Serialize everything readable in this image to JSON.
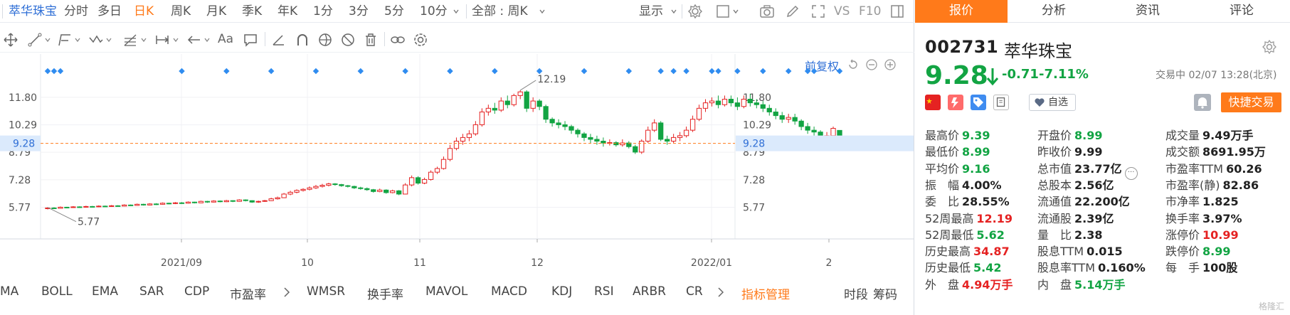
{
  "period_bar": {
    "stock_name": "萃华珠宝",
    "periods": [
      "分时",
      "多日",
      "日K",
      "周K",
      "月K",
      "季K",
      "年K",
      "1分",
      "3分",
      "5分",
      "10分"
    ],
    "active_period": "日K",
    "overlay_select": "全部 : 周K",
    "display_label": "显示",
    "vs_label": "VS",
    "f10_label": "F10"
  },
  "chart_toolbar": {
    "adjust_label": "前复权"
  },
  "chart_data": {
    "type": "candlestick",
    "x_tick_labels": [
      "2021/09",
      "10",
      "11",
      "12",
      "2022/01",
      "2"
    ],
    "y_tick_labels": [
      "11.80",
      "10.29",
      "8.79",
      "7.28",
      "5.77"
    ],
    "y_ticks": [
      11.8,
      10.29,
      8.79,
      7.28,
      5.77
    ],
    "ylim": [
      4.9,
      13.2
    ],
    "current_price": 9.28,
    "current_price_label": "9.28",
    "high_marker": {
      "value": 12.19,
      "label": "12.19"
    },
    "low_marker": {
      "value": 5.77,
      "label": "5.77"
    },
    "candles": [
      [
        5.7,
        5.74,
        5.66,
        5.78
      ],
      [
        5.74,
        5.72,
        5.68,
        5.78
      ],
      [
        5.72,
        5.78,
        5.7,
        5.82
      ],
      [
        5.78,
        5.76,
        5.72,
        5.8
      ],
      [
        5.76,
        5.8,
        5.74,
        5.84
      ],
      [
        5.8,
        5.78,
        5.75,
        5.83
      ],
      [
        5.78,
        5.82,
        5.76,
        5.86
      ],
      [
        5.82,
        5.8,
        5.77,
        5.85
      ],
      [
        5.8,
        5.84,
        5.78,
        5.88
      ],
      [
        5.84,
        5.82,
        5.79,
        5.87
      ],
      [
        5.82,
        5.86,
        5.8,
        5.9
      ],
      [
        5.86,
        5.84,
        5.81,
        5.89
      ],
      [
        5.84,
        5.9,
        5.82,
        5.94
      ],
      [
        5.9,
        5.88,
        5.85,
        5.93
      ],
      [
        5.88,
        5.94,
        5.86,
        5.98
      ],
      [
        5.94,
        5.9,
        5.87,
        5.97
      ],
      [
        5.9,
        5.96,
        5.88,
        6.0
      ],
      [
        5.96,
        5.94,
        5.9,
        6.0
      ],
      [
        5.94,
        6.0,
        5.92,
        6.04
      ],
      [
        6.0,
        5.98,
        5.94,
        6.03
      ],
      [
        5.98,
        6.02,
        5.95,
        6.06
      ],
      [
        6.02,
        6.0,
        5.96,
        6.06
      ],
      [
        6.0,
        6.06,
        5.98,
        6.1
      ],
      [
        6.06,
        6.02,
        5.99,
        6.08
      ],
      [
        6.02,
        6.1,
        6.0,
        6.14
      ],
      [
        6.1,
        6.06,
        6.02,
        6.13
      ],
      [
        6.06,
        6.12,
        6.04,
        6.16
      ],
      [
        6.12,
        6.08,
        6.05,
        6.15
      ],
      [
        6.08,
        6.14,
        6.06,
        6.18
      ],
      [
        6.14,
        6.1,
        6.06,
        6.16
      ],
      [
        6.1,
        6.18,
        6.08,
        6.22
      ],
      [
        6.18,
        6.14,
        6.1,
        6.21
      ],
      [
        6.14,
        6.06,
        6.02,
        6.16
      ],
      [
        6.06,
        6.1,
        6.02,
        6.14
      ],
      [
        6.1,
        6.14,
        6.07,
        6.18
      ],
      [
        6.14,
        6.24,
        6.12,
        6.3
      ],
      [
        6.24,
        6.3,
        6.2,
        6.36
      ],
      [
        6.3,
        6.5,
        6.28,
        6.56
      ],
      [
        6.5,
        6.6,
        6.44,
        6.68
      ],
      [
        6.6,
        6.7,
        6.54,
        6.76
      ],
      [
        6.7,
        6.76,
        6.64,
        6.82
      ],
      [
        6.76,
        6.84,
        6.7,
        6.92
      ],
      [
        6.84,
        6.92,
        6.78,
        7.0
      ],
      [
        6.92,
        6.98,
        6.86,
        7.06
      ],
      [
        6.98,
        7.06,
        6.92,
        7.12
      ],
      [
        7.06,
        7.02,
        6.96,
        7.1
      ],
      [
        7.02,
        6.96,
        6.9,
        7.06
      ],
      [
        6.96,
        6.92,
        6.86,
        7.0
      ],
      [
        6.92,
        6.84,
        6.78,
        6.96
      ],
      [
        6.84,
        6.8,
        6.74,
        6.9
      ],
      [
        6.8,
        6.74,
        6.68,
        6.86
      ],
      [
        6.74,
        6.64,
        6.58,
        6.78
      ],
      [
        6.64,
        6.72,
        6.6,
        6.8
      ],
      [
        6.72,
        6.58,
        6.52,
        6.76
      ],
      [
        6.58,
        6.68,
        6.54,
        6.74
      ],
      [
        6.68,
        6.5,
        6.44,
        6.72
      ],
      [
        6.5,
        7.0,
        6.48,
        7.1
      ],
      [
        7.0,
        7.4,
        6.92,
        7.52
      ],
      [
        7.4,
        7.1,
        7.02,
        7.48
      ],
      [
        7.1,
        7.3,
        7.04,
        7.4
      ],
      [
        7.3,
        7.7,
        7.24,
        7.8
      ],
      [
        7.7,
        7.9,
        7.6,
        8.0
      ],
      [
        7.9,
        8.4,
        7.84,
        8.56
      ],
      [
        8.4,
        9.0,
        8.3,
        9.2
      ],
      [
        9.0,
        9.4,
        8.9,
        9.6
      ],
      [
        9.4,
        9.6,
        9.2,
        9.8
      ],
      [
        9.6,
        9.8,
        9.4,
        10.0
      ],
      [
        9.8,
        10.3,
        9.7,
        10.5
      ],
      [
        10.3,
        11.0,
        10.2,
        11.2
      ],
      [
        11.0,
        11.2,
        10.8,
        11.4
      ],
      [
        11.2,
        11.1,
        10.9,
        11.5
      ],
      [
        11.1,
        11.6,
        11.0,
        11.8
      ],
      [
        11.6,
        11.4,
        11.2,
        11.9
      ],
      [
        11.4,
        11.9,
        11.3,
        12.0
      ],
      [
        11.9,
        12.1,
        11.7,
        12.19
      ],
      [
        12.1,
        11.2,
        11.0,
        12.19
      ],
      [
        11.2,
        11.6,
        11.0,
        11.8
      ],
      [
        11.6,
        11.3,
        11.1,
        11.7
      ],
      [
        11.3,
        10.6,
        10.4,
        11.4
      ],
      [
        10.6,
        10.4,
        10.2,
        10.7
      ],
      [
        10.4,
        10.3,
        10.1,
        10.6
      ],
      [
        10.3,
        10.2,
        10.0,
        10.5
      ],
      [
        10.2,
        10.0,
        9.8,
        10.3
      ],
      [
        10.0,
        9.8,
        9.6,
        10.1
      ],
      [
        9.8,
        9.6,
        9.4,
        9.9
      ],
      [
        9.6,
        9.5,
        9.3,
        9.8
      ],
      [
        9.5,
        9.4,
        9.2,
        9.7
      ],
      [
        9.4,
        9.3,
        9.1,
        9.6
      ],
      [
        9.3,
        9.32,
        9.16,
        9.5
      ],
      [
        9.32,
        9.2,
        9.1,
        9.4
      ],
      [
        9.2,
        9.3,
        9.1,
        9.5
      ],
      [
        9.3,
        9.1,
        9.0,
        9.4
      ],
      [
        9.1,
        8.8,
        8.7,
        9.2
      ],
      [
        8.8,
        9.4,
        8.7,
        9.5
      ],
      [
        9.4,
        10.0,
        9.3,
        10.2
      ],
      [
        10.0,
        10.4,
        9.9,
        10.6
      ],
      [
        10.4,
        9.5,
        9.4,
        10.5
      ],
      [
        9.5,
        9.4,
        9.2,
        9.7
      ],
      [
        9.4,
        9.6,
        9.3,
        9.8
      ],
      [
        9.6,
        9.7,
        9.4,
        9.9
      ],
      [
        9.7,
        10.0,
        9.6,
        10.2
      ],
      [
        10.0,
        10.6,
        9.9,
        10.8
      ],
      [
        10.6,
        11.2,
        10.5,
        11.4
      ],
      [
        11.2,
        11.5,
        11.0,
        11.7
      ],
      [
        11.5,
        11.6,
        11.3,
        11.8
      ],
      [
        11.6,
        11.4,
        11.2,
        11.9
      ],
      [
        11.4,
        11.7,
        11.3,
        11.9
      ],
      [
        11.7,
        11.5,
        11.3,
        11.9
      ],
      [
        11.5,
        11.3,
        11.1,
        11.8
      ],
      [
        11.3,
        11.7,
        11.2,
        11.9
      ],
      [
        11.7,
        11.5,
        11.3,
        12.0
      ],
      [
        11.5,
        11.4,
        11.2,
        11.7
      ],
      [
        11.4,
        11.2,
        11.0,
        11.6
      ],
      [
        11.2,
        11.0,
        10.8,
        11.4
      ],
      [
        11.0,
        10.8,
        10.6,
        11.2
      ],
      [
        10.8,
        10.6,
        10.4,
        11.0
      ],
      [
        10.6,
        10.7,
        10.4,
        10.9
      ],
      [
        10.7,
        10.5,
        10.3,
        10.9
      ],
      [
        10.5,
        10.2,
        10.0,
        10.6
      ],
      [
        10.2,
        10.0,
        9.8,
        10.4
      ],
      [
        10.0,
        9.9,
        9.7,
        10.2
      ],
      [
        9.9,
        9.6,
        9.4,
        10.0
      ],
      [
        9.6,
        9.7,
        9.4,
        9.9
      ],
      [
        9.7,
        10.1,
        9.6,
        10.2
      ],
      [
        9.99,
        9.28,
        8.99,
        9.39
      ]
    ],
    "signal_markers_present": true
  },
  "indicators": {
    "items": [
      "MA",
      "BOLL",
      "EMA",
      "SAR",
      "CDP",
      "市盈率",
      "WMSR",
      "换手率",
      "MAVOL",
      "MACD",
      "KDJ",
      "RSI",
      "ARBR",
      "CR"
    ],
    "manage": "指标管理",
    "right_items": [
      "时段",
      "筹码"
    ]
  },
  "quote": {
    "tabs": [
      "报价",
      "分析",
      "资讯",
      "评论"
    ],
    "active_tab": "报价",
    "code": "002731",
    "name": "萃华珠宝",
    "price": "9.28",
    "change": "-0.71",
    "change_pct": "-7.11%",
    "status": "交易中 02/07 13:28(北京)",
    "watch_label": "自选",
    "quick_trade": "快捷交易",
    "fields": [
      {
        "k": "最高价",
        "v": "9.39",
        "c": "g"
      },
      {
        "k": "开盘价",
        "v": "8.99",
        "c": "g"
      },
      {
        "k": "成交量",
        "v": "9.49万手",
        "c": ""
      },
      {
        "k": "最低价",
        "v": "8.99",
        "c": "g"
      },
      {
        "k": "昨收价",
        "v": "9.99",
        "c": ""
      },
      {
        "k": "成交额",
        "v": "8691.95万",
        "c": ""
      },
      {
        "k": "平均价",
        "v": "9.16",
        "c": "g"
      },
      {
        "k": "总市值",
        "v": "23.77亿",
        "c": ""
      },
      {
        "k": "市盈率TTM",
        "v": "60.26",
        "c": ""
      },
      {
        "k": "振　幅",
        "v": "4.00%",
        "c": ""
      },
      {
        "k": "总股本",
        "v": "2.56亿",
        "c": ""
      },
      {
        "k": "市盈率(静)",
        "v": "82.86",
        "c": ""
      },
      {
        "k": "委　比",
        "v": "28.55%",
        "c": ""
      },
      {
        "k": "流通值",
        "v": "22.200亿",
        "c": ""
      },
      {
        "k": "市净率",
        "v": "1.825",
        "c": ""
      },
      {
        "k": "52周最高",
        "v": "12.19",
        "c": "r"
      },
      {
        "k": "流通股",
        "v": "2.39亿",
        "c": ""
      },
      {
        "k": "换手率",
        "v": "3.97%",
        "c": ""
      },
      {
        "k": "52周最低",
        "v": "5.62",
        "c": "g"
      },
      {
        "k": "量　比",
        "v": "2.38",
        "c": ""
      },
      {
        "k": "涨停价",
        "v": "10.99",
        "c": "r"
      },
      {
        "k": "历史最高",
        "v": "34.87",
        "c": "r"
      },
      {
        "k": "股息TTM",
        "v": "0.015",
        "c": ""
      },
      {
        "k": "跌停价",
        "v": "8.99",
        "c": "g"
      },
      {
        "k": "历史最低",
        "v": "5.42",
        "c": "g"
      },
      {
        "k": "股息率TTM",
        "v": "0.160%",
        "c": ""
      },
      {
        "k": "每　手",
        "v": "100股",
        "c": ""
      },
      {
        "k": "外　盘",
        "v": "4.94万手",
        "c": "r"
      },
      {
        "k": "内　盘",
        "v": "5.14万手",
        "c": "g"
      },
      {
        "k": "",
        "v": "",
        "c": ""
      }
    ],
    "watermark": "格隆汇"
  },
  "colors": {
    "accent": "#ff7a1a",
    "up": "#e52222",
    "down": "#12a443",
    "link": "#2f6fd6",
    "signal": "#2f8cf0"
  }
}
